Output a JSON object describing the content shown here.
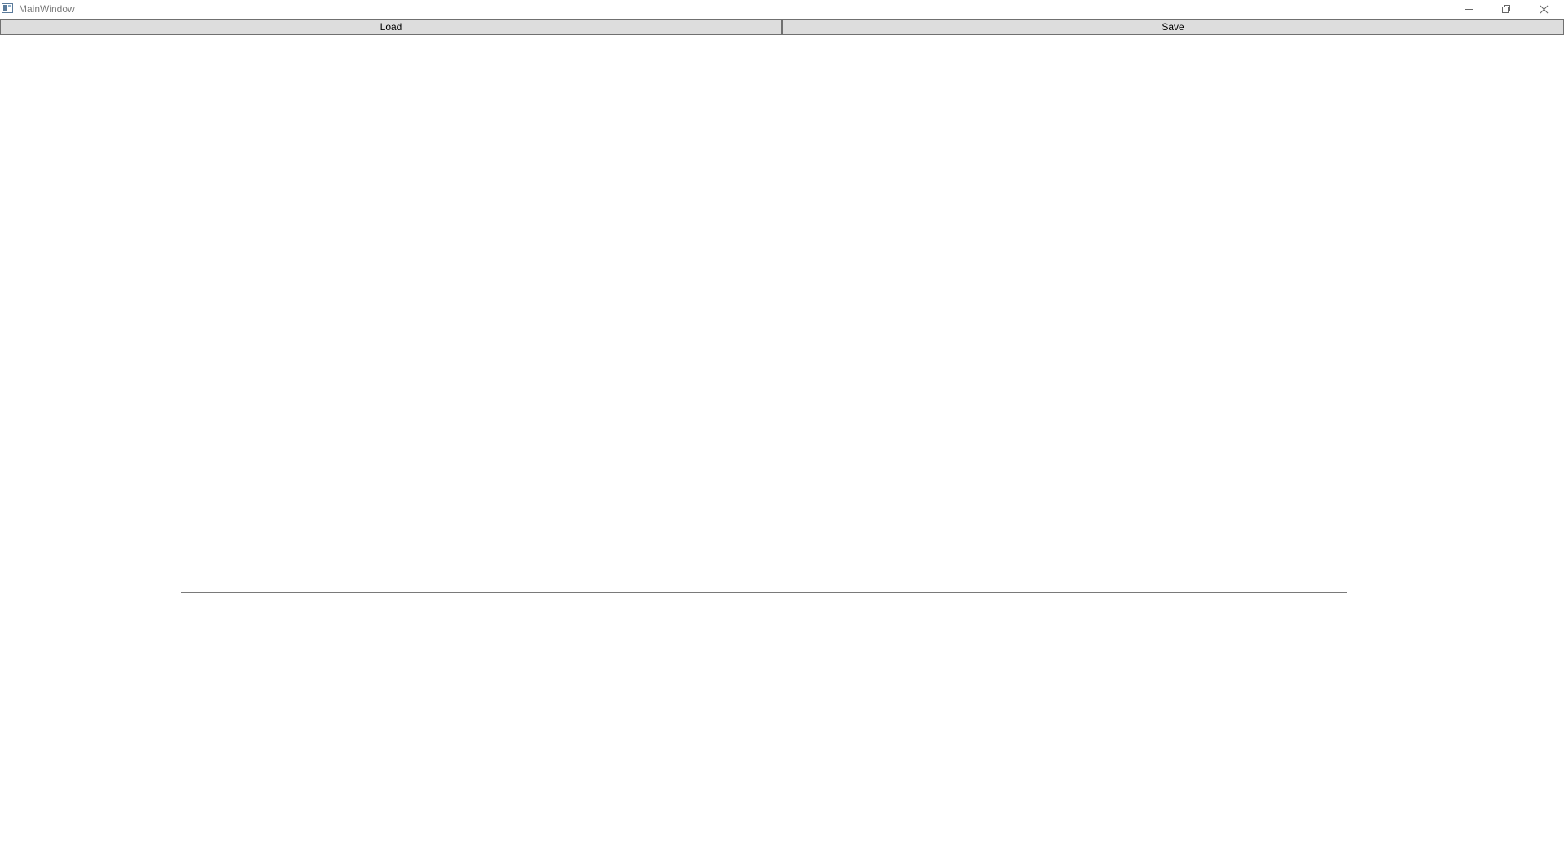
{
  "window": {
    "title": "MainWindow",
    "app_icon": "window-app-icon",
    "controls": {
      "minimize": "minimize-icon",
      "restore": "restore-icon",
      "close": "close-icon"
    }
  },
  "toolbar": {
    "load_label": "Load",
    "save_label": "Save"
  },
  "colors": {
    "button_bg": "#dddddd",
    "button_border": "#707070",
    "line": "#7a7a7a",
    "title_text": "#7a7a7a"
  }
}
